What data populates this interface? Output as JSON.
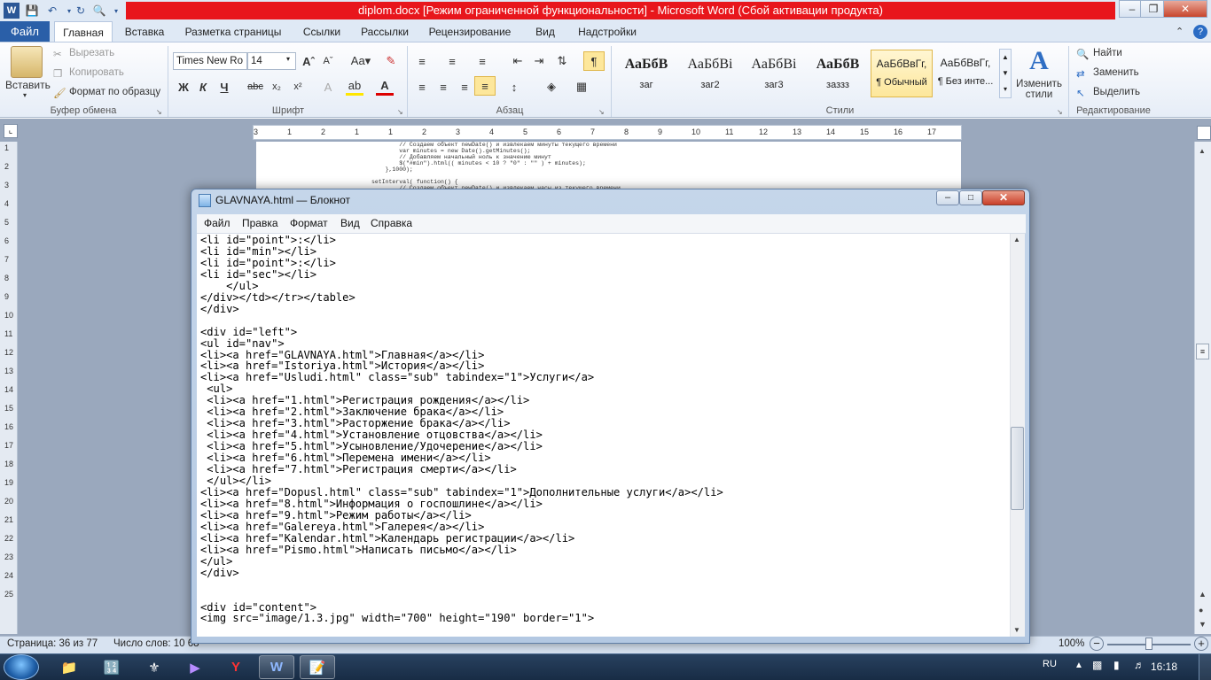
{
  "word": {
    "title": "diplom.docx [Режим ограниченной функциональности] - Microsoft Word (Сбой активации продукта)",
    "tabs": [
      "Файл",
      "Главная",
      "Вставка",
      "Разметка страницы",
      "Ссылки",
      "Рассылки",
      "Рецензирование",
      "Вид",
      "Надстройки"
    ],
    "clipboard": {
      "paste": "Вставить",
      "cut": "Вырезать",
      "copy": "Копировать",
      "format_painter": "Формат по образцу",
      "group": "Буфер обмена"
    },
    "font": {
      "family": "Times New Ro",
      "size": "14",
      "group": "Шрифт"
    },
    "paragraph": {
      "group": "Абзац"
    },
    "styles": {
      "group": "Стили",
      "items": [
        {
          "preview": "АаБбВ",
          "name": "заг"
        },
        {
          "preview": "АаБбВі",
          "name": "заг2"
        },
        {
          "preview": "АаБбВі",
          "name": "заг3"
        },
        {
          "preview": "АаБбВ",
          "name": "заззз"
        },
        {
          "preview": "АаБбВвГг,",
          "name": "¶ Обычный"
        },
        {
          "preview": "АаБбВвГг,",
          "name": "¶ Без инте..."
        }
      ],
      "change": "Изменить стили"
    },
    "editing": {
      "find": "Найти",
      "replace": "Заменить",
      "select": "Выделить",
      "group": "Редактирование"
    },
    "ruler_numbers": [
      "3",
      "1",
      "2",
      "1",
      "1",
      "2",
      "3",
      "4",
      "5",
      "6",
      "7",
      "8",
      "9",
      "10",
      "11",
      "12",
      "13",
      "14",
      "15",
      "16",
      "17"
    ],
    "left_ruler": [
      "1",
      "2",
      "3",
      "4",
      "5",
      "6",
      "7",
      "8",
      "9",
      "10",
      "11",
      "12",
      "13",
      "14",
      "15",
      "16",
      "17",
      "18",
      "19",
      "20",
      "21",
      "22",
      "23",
      "24",
      "25"
    ],
    "page_code": [
      "        // Создаем объект newDate() и извлекаем минуты текущего времени",
      "        var minutes = new Date().getMinutes();",
      "        // Добавляем начальный ноль к значению минут",
      "        $(\"#min\").html(( minutes < 10 ? \"0\" : \"\" ) + minutes);",
      "    },1000);",
      "",
      "setInterval( function() {",
      "        // Создаем объект newDate() и извлекаем часы из текущего времени"
    ],
    "status": {
      "page": "Страница: 36 из 77",
      "words": "Число слов: 10 68",
      "zoom": "100%"
    }
  },
  "notepad": {
    "title": "GLAVNAYA.html — Блокнот",
    "menu": [
      "Файл",
      "Правка",
      "Формат",
      "Вид",
      "Справка"
    ],
    "lines": [
      "<li id=\"point\">:</li>",
      "<li id=\"min\"></li>",
      "<li id=\"point\">:</li>",
      "<li id=\"sec\"></li>",
      "    </ul>",
      "</div></td></tr></table>",
      "</div>",
      "",
      "<div id=\"left\">",
      "<ul id=\"nav\">",
      "<li><a href=\"GLAVNAYA.html\">Главная</a></li>",
      "<li><a href=\"Istoriya.html\">История</a></li>",
      "<li><a href=\"Usludi.html\" class=\"sub\" tabindex=\"1\">Услуги</a>",
      " <ul>",
      " <li><a href=\"1.html\">Регистрация рождения</a></li>",
      " <li><a href=\"2.html\">Заключение брака</a></li>",
      " <li><a href=\"3.html\">Расторжение брака</a></li>",
      " <li><a href=\"4.html\">Установление отцовства</a></li>",
      " <li><a href=\"5.html\">Усыновление/Удочерение</a></li>",
      " <li><a href=\"6.html\">Перемена имени</a></li>",
      " <li><a href=\"7.html\">Регистрация смерти</a></li>",
      " </ul></li>",
      "<li><a href=\"Dopusl.html\" class=\"sub\" tabindex=\"1\">Дополнительные услуги</a></li>",
      "<li><a href=\"8.html\">Информация о госпошлине</a></li>",
      "<li><a href=\"9.html\">Режим работы</a></li>",
      "<li><a href=\"Galereya.html\">Галерея</a></li>",
      "<li><a href=\"Kalendar.html\">Календарь регистрации</a></li>",
      "<li><a href=\"Pismo.html\">Написать письмо</a></li>",
      "</ul>",
      "</div>",
      "",
      "",
      "<div id=\"content\">",
      "<img src=\"image/1.3.jpg\" width=\"700\" height=\"190\" border=\"1\">"
    ]
  },
  "taskbar": {
    "lang": "RU",
    "time": "16:18"
  }
}
